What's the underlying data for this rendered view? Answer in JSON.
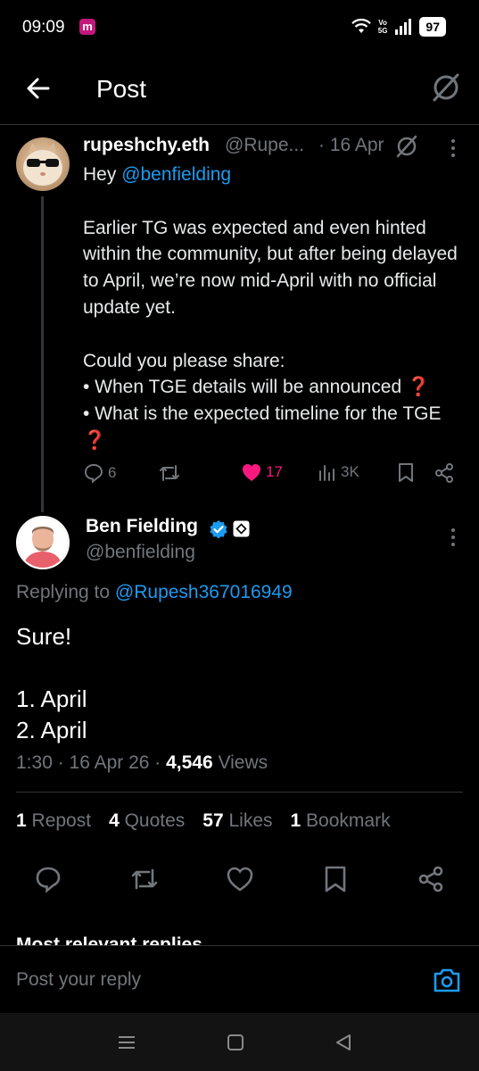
{
  "status_bar": {
    "time": "09:09",
    "app_badge": "m",
    "network_label_top": "Vo",
    "network_label_bottom": "5G",
    "battery": "97"
  },
  "header": {
    "title": "Post"
  },
  "original_post": {
    "display_name": "rupeshchy.eth",
    "handle": "@Rupe...",
    "date": "· 16 Apr",
    "greeting_prefix": "Hey ",
    "greeting_mention": "@benfielding",
    "paragraph_1": "Earlier TG was expected and even hinted within the community, but after being delayed to April, we’re now mid-April with no official update yet.",
    "paragraph_2": "Could you please share:",
    "bullet_1": "• When TGE details will be announced ",
    "bullet_2": "• What is the expected timeline for the TGE ",
    "question_emoji": "❓",
    "replies": "6",
    "likes": "17",
    "views": "3K"
  },
  "reply_post": {
    "display_name": "Ben Fielding",
    "handle": "@benfielding",
    "replying_prefix": "Replying to ",
    "replying_handle": "@Rupesh367016949",
    "line_1": "Sure!",
    "line_2": "1. April",
    "line_3": "2. April",
    "time_date": "1:30 · 16 Apr 26 · ",
    "views_count": "4,546",
    "views_label": " Views",
    "reposts_count": "1",
    "reposts_label": " Repost",
    "quotes_count": "4",
    "quotes_label": " Quotes",
    "likes_count": "57",
    "likes_label": " Likes",
    "bookmarks_count": "1",
    "bookmarks_label": " Bookmark"
  },
  "replies_sort": "Most relevant replies ⌄",
  "reply_bar": {
    "placeholder": "Post your reply"
  },
  "colors": {
    "accent": "#1d9bf0",
    "like": "#f91880",
    "muted": "#71767b",
    "background": "#000000"
  }
}
